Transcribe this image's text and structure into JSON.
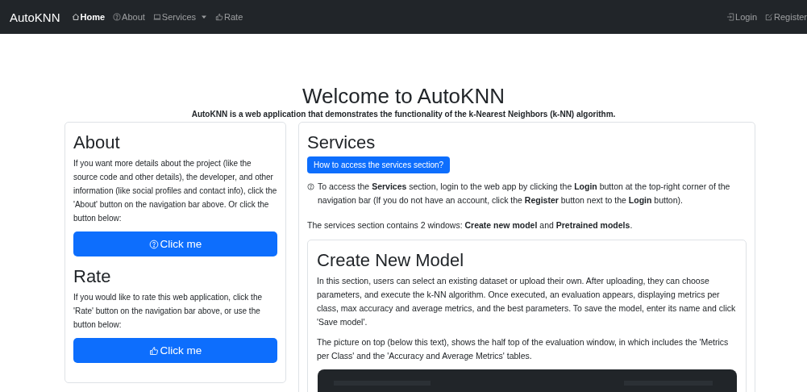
{
  "navbar": {
    "brand": "AutoKNN",
    "items": [
      {
        "label": "Home",
        "selected": true,
        "dropdown": false
      },
      {
        "label": "About",
        "selected": false,
        "dropdown": false
      },
      {
        "label": "Services",
        "selected": false,
        "dropdown": true
      },
      {
        "label": "Rate",
        "selected": false,
        "dropdown": false
      }
    ],
    "right_items": [
      {
        "label": "Login"
      },
      {
        "label": "Register"
      }
    ]
  },
  "header": {
    "title": "Welcome to AutoKNN",
    "subtitle": "AutoKNN is a web application that demonstrates the functionality of the k-Nearest Neighbors (k-NN) algorithm."
  },
  "sidebar": [
    {
      "title": "About",
      "text": "If you want more details about the project (like the source code and other details), the developer, and other information (like social profiles and contact info), click the 'About' button on the navigation bar above. Or click the button below:",
      "button": {
        "label": "Click me"
      }
    },
    {
      "title": "Rate",
      "text": "If you would like to rate this web application, click the 'Rate' button on the navigation bar above, or use the button below:",
      "button": {
        "label": "Click me"
      }
    }
  ],
  "services": {
    "title": "Services",
    "button": "How to access the services section?",
    "info": "To access the **Services** section, login to the web app by clicking the **Login** button at the top-right corner of the navigation bar (If you do not have an account, click the **Register** button next to the **Login** button).",
    "summary": "The services section contains 2 windows: **Create new model** and **Pretrained models**.",
    "create": {
      "title": "Create New Model",
      "paragraphs": [
        "In this section, users can select an existing dataset or upload their own. After uploading, they can choose parameters, and execute the k-NN algorithm. Once executed, an evaluation appears, displaying metrics per class, max accuracy and average metrics, and the best parameters. To save the model, enter its name and click 'Save model'.",
        "The picture on top (below this text), shows the half top of the evaluation window, in which includes the 'Metrics per Class' and the 'Accuracy and Average Metrics' tables."
      ]
    }
  }
}
